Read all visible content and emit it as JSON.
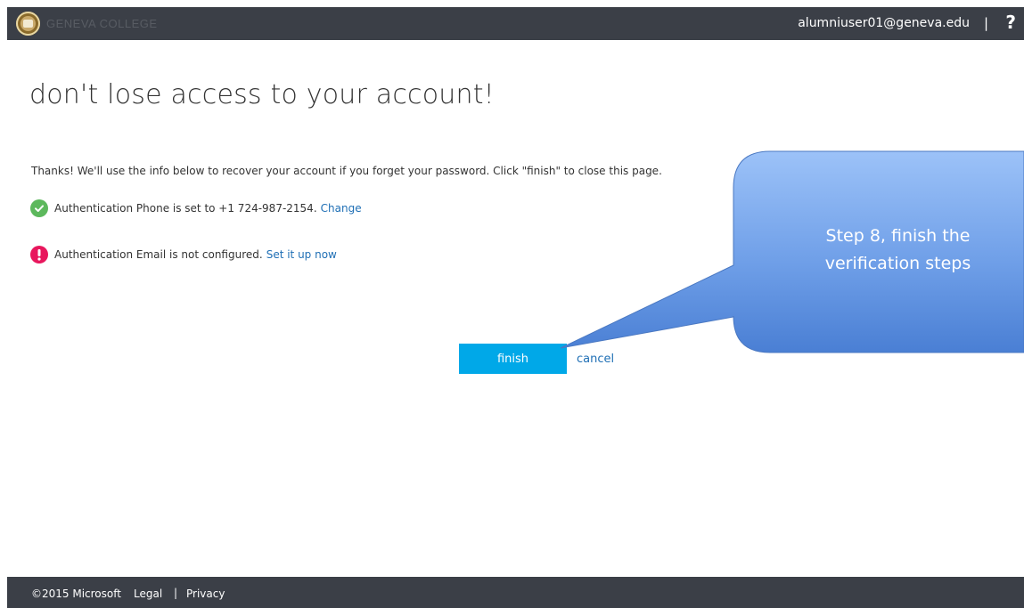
{
  "header": {
    "org_name": "GENEVA COLLEGE",
    "user_email": "alumniuser01@geneva.edu",
    "separator": "|",
    "help_label": "?",
    "bar_color": "#3b3f47"
  },
  "main": {
    "title": "don't lose access to your account!",
    "intro": "Thanks! We'll use the info below to recover your account if you forget your password. Click \"finish\" to close this page.",
    "phone": {
      "status": "ok",
      "icon": "check-circle-icon",
      "text": "Authentication Phone is set to +1 724-987-2154.",
      "link": "Change"
    },
    "email": {
      "status": "error",
      "icon": "exclamation-circle-icon",
      "text": "Authentication Email is not configured.",
      "link": "Set it up now"
    },
    "finish_label": "finish",
    "cancel_label": "cancel",
    "accent_color": "#00a8e8",
    "link_color": "#1f6fb5"
  },
  "callout": {
    "text": "Step 8, finish the verification steps",
    "color": "#5b8fde"
  },
  "footer": {
    "copyright": "©2015 Microsoft",
    "legal": "Legal",
    "separator": "|",
    "privacy": "Privacy"
  }
}
